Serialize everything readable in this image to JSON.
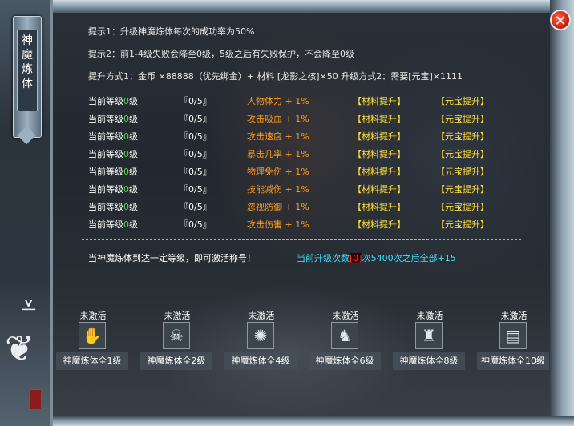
{
  "window": {
    "title": "神魔炼体",
    "close_symbol": "✕"
  },
  "tips": {
    "tip1": "提示1：升级神魔炼体每次的成功率为50%",
    "tip2": "提示2：前1-4级失败会降至0级，5级之后有失败保护，不会降至0级",
    "methods": "提升方式1：金币 ×88888（优先绑金）+ 材料 [龙影之核]×50  升级方式2：需要[元宝]×1111"
  },
  "rows": [
    {
      "level_prefix": "当前等级",
      "level_num": "0",
      "level_suffix": "级",
      "progress": "『0/5』",
      "attribute": "人物体力 + 1%",
      "material_btn": "【材料提升】",
      "yuanbao_btn": "【元宝提升】"
    },
    {
      "level_prefix": "当前等级",
      "level_num": "0",
      "level_suffix": "级",
      "progress": "『0/5』",
      "attribute": "攻击吸血 + 1%",
      "material_btn": "【材料提升】",
      "yuanbao_btn": "【元宝提升】"
    },
    {
      "level_prefix": "当前等级",
      "level_num": "0",
      "level_suffix": "级",
      "progress": "『0/5』",
      "attribute": "攻击速度 + 1%",
      "material_btn": "【材料提升】",
      "yuanbao_btn": "【元宝提升】"
    },
    {
      "level_prefix": "当前等级",
      "level_num": "0",
      "level_suffix": "级",
      "progress": "『0/5』",
      "attribute": "暴击几率 + 1%",
      "material_btn": "【材料提升】",
      "yuanbao_btn": "【元宝提升】"
    },
    {
      "level_prefix": "当前等级",
      "level_num": "0",
      "level_suffix": "级",
      "progress": "『0/5』",
      "attribute": "物理免伤 + 1%",
      "material_btn": "【材料提升】",
      "yuanbao_btn": "【元宝提升】"
    },
    {
      "level_prefix": "当前等级",
      "level_num": "0",
      "level_suffix": "级",
      "progress": "『0/5』",
      "attribute": "技能减伤 + 1%",
      "material_btn": "【材料提升】",
      "yuanbao_btn": "【元宝提升】"
    },
    {
      "level_prefix": "当前等级",
      "level_num": "0",
      "level_suffix": "级",
      "progress": "『0/5』",
      "attribute": "忽视防御 + 1%",
      "material_btn": "【材料提升】",
      "yuanbao_btn": "【元宝提升】"
    },
    {
      "level_prefix": "当前等级",
      "level_num": "0",
      "level_suffix": "级",
      "progress": "『0/5』",
      "attribute": "攻击伤害 + 1%",
      "material_btn": "【材料提升】",
      "yuanbao_btn": "【元宝提升】"
    }
  ],
  "notes": {
    "title_hint": "当神魔炼体到达一定等级，即可激活称号！",
    "upgrade_prefix": "当前升级次数",
    "upgrade_count": "[0]",
    "upgrade_suffix": "次5400次之后全部+15"
  },
  "badges": [
    {
      "status": "未激活",
      "label": "神魔炼体全1级",
      "icon": "claw-icon"
    },
    {
      "status": "未激活",
      "label": "神魔炼体全2级",
      "icon": "skull-icon"
    },
    {
      "status": "未激活",
      "label": "神魔炼体全4级",
      "icon": "burst-icon"
    },
    {
      "status": "未激活",
      "label": "神魔炼体全6级",
      "icon": "demon-icon"
    },
    {
      "status": "未激活",
      "label": "神魔炼体全8级",
      "icon": "beast-icon"
    },
    {
      "status": "未激活",
      "label": "神魔炼体全10级",
      "icon": "scroll-icon"
    }
  ],
  "colors": {
    "attribute": "#ff9b1a",
    "button": "#ffde3a",
    "level_number": "#3fe63f",
    "upgrade_text": "#3fe0ff",
    "upgrade_count": "#ff3030"
  }
}
